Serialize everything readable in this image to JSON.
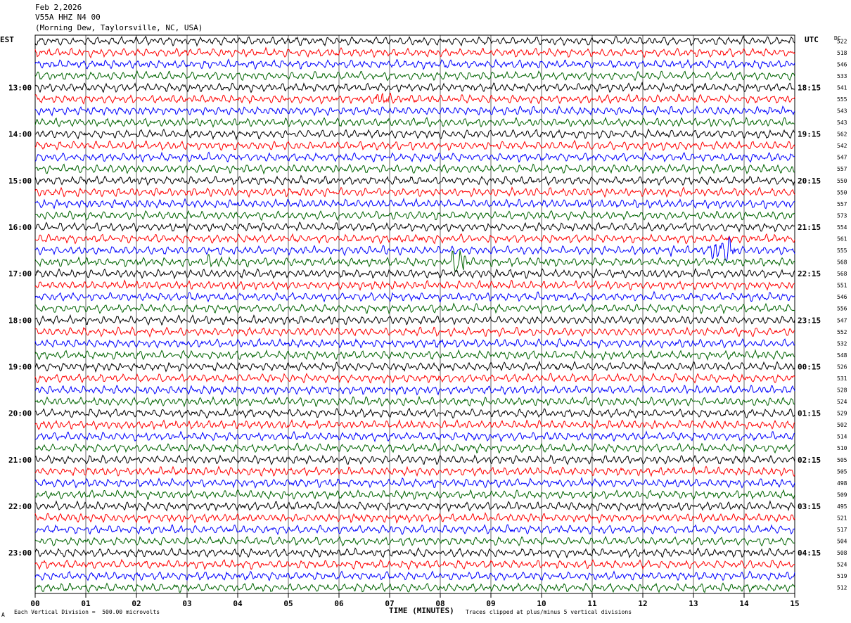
{
  "header": {
    "date": "Feb 2,2026",
    "station": "V55A HHZ N4 00",
    "location": "(Morning Dew, Taylorsville, NC, USA)"
  },
  "labels": {
    "left_zone": "EST",
    "right_zone": "UTC",
    "dc": "DC",
    "scale_note": "Each Vertical Division =  500.00 microvolts",
    "scale_mark": "A",
    "clip_note": "Traces clipped at plus/minus 5 vertical divisions"
  },
  "colors": {
    "trace_cycle": [
      "#000000",
      "#ff0000",
      "#0000ff",
      "#006400"
    ],
    "grid": "#000000"
  },
  "chart_data": {
    "type": "helicorder",
    "xlabel": "TIME (MINUTES)",
    "x_range": [
      0,
      15
    ],
    "x_ticks": [
      "00",
      "01",
      "02",
      "03",
      "04",
      "05",
      "06",
      "07",
      "08",
      "09",
      "10",
      "11",
      "12",
      "13",
      "14",
      "15"
    ],
    "rows_per_hour": 4,
    "left_hour_labels": [
      "13:00",
      "14:00",
      "15:00",
      "16:00",
      "17:00",
      "18:00",
      "19:00",
      "20:00",
      "21:00",
      "22:00",
      "23:00"
    ],
    "right_hour_labels": [
      "18:15",
      "19:15",
      "20:15",
      "21:15",
      "22:15",
      "23:15",
      "00:15",
      "01:15",
      "02:15",
      "03:15",
      "04:15"
    ],
    "dc_offsets": [
      522,
      518,
      546,
      533,
      541,
      555,
      543,
      543,
      562,
      542,
      547,
      557,
      550,
      550,
      557,
      573,
      554,
      561,
      555,
      568,
      568,
      551,
      546,
      556,
      547,
      552,
      532,
      548,
      526,
      531,
      528,
      524,
      529,
      502,
      514,
      510,
      505,
      505,
      498,
      509,
      495,
      521,
      517,
      504,
      508,
      524,
      519,
      512
    ],
    "events": [
      {
        "row": 5,
        "minute_start": 6.65,
        "minute_end": 7.05,
        "scale": 2.2
      },
      {
        "row": 19,
        "minute_start": 3.3,
        "minute_end": 3.7,
        "scale": 1.8
      },
      {
        "row": 19,
        "minute_start": 8.2,
        "minute_end": 8.55,
        "scale": 5.0
      },
      {
        "row": 18,
        "minute_start": 12.45,
        "minute_end": 12.6,
        "scale": 1.5
      },
      {
        "row": 18,
        "minute_start": 13.25,
        "minute_end": 13.95,
        "scale": 3.5
      }
    ]
  }
}
